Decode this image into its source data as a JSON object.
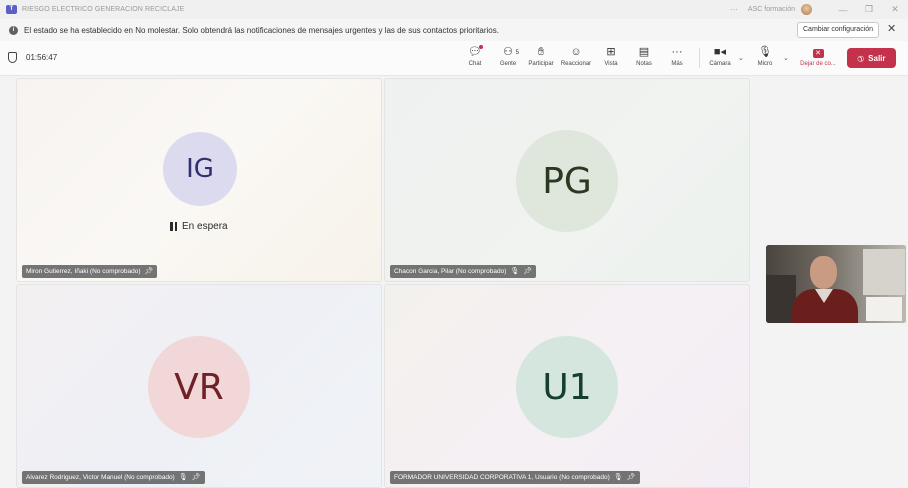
{
  "window": {
    "title": "RIESGO ELECTRICO GENERACION RECICLAJE",
    "more": "···",
    "org": "ASC formación"
  },
  "notice": {
    "message": "El estado se ha establecido en No molestar. Solo obtendrá las notificaciones de mensajes urgentes y las de sus contactos prioritarios.",
    "change_button": "Cambiar configuración",
    "close": "✕"
  },
  "toolbar": {
    "timer": "01:56:47",
    "chat": "Chat",
    "people": "Gente",
    "people_count": "5",
    "raise_hand": "Participar",
    "react": "Reaccionar",
    "view": "Vista",
    "notes": "Notas",
    "more": "Más",
    "camera": "Cámara",
    "mic": "Micro",
    "share": "Dejar de co...",
    "leave": "Salir"
  },
  "participants": [
    {
      "initials": "IG",
      "name": "Miron Gutierrez, Iñaki (No comprobado)",
      "status": "En espera"
    },
    {
      "initials": "PG",
      "name": "Chacon Garcia, Pilar (No comprobado)"
    },
    {
      "initials": "VR",
      "name": "Alvarez Rodriguez, Victor Manuel (No comprobado)"
    },
    {
      "initials": "U1",
      "name": "FORMADOR UNIVERSIDAD CORPORATIVA 1, Usuario (No comprobado)"
    }
  ],
  "colors": {
    "accent": "#5b5fc7",
    "leave": "#c4314b"
  }
}
